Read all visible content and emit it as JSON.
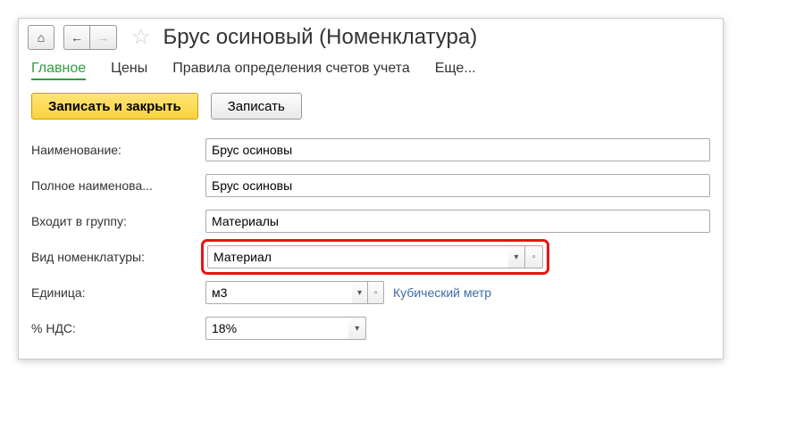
{
  "header": {
    "title": "Брус осиновый (Номенклатура)",
    "star_glyph": "☆",
    "home_glyph": "⌂",
    "back_glyph": "←",
    "forward_glyph": "→"
  },
  "tabs": {
    "main": "Главное",
    "prices": "Цены",
    "rules": "Правила определения счетов учета",
    "more": "Еще..."
  },
  "toolbar": {
    "save_close": "Записать и закрыть",
    "save": "Записать"
  },
  "form": {
    "name_label": "Наименование:",
    "name_value": "Брус осиновы",
    "fullname_label": "Полное наименова...",
    "fullname_value": "Брус осиновы",
    "group_label": "Входит в группу:",
    "group_value": "Материалы",
    "kind_label": "Вид номенклатуры:",
    "kind_value": "Материал",
    "unit_label": "Единица:",
    "unit_value": "м3",
    "unit_full": "Кубический метр",
    "vat_label": "% НДС:",
    "vat_value": "18%",
    "dropdown_glyph": "▾",
    "open_glyph": "▫"
  }
}
